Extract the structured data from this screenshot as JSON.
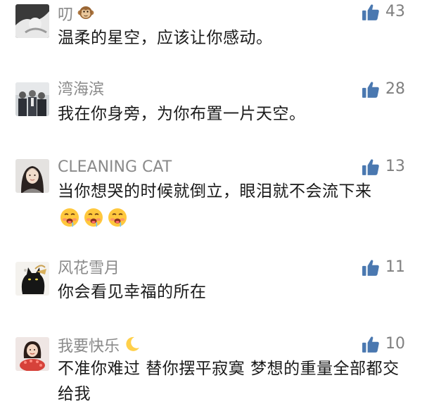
{
  "comments": [
    {
      "name": "叨",
      "text": "温柔的星空，应该让你感动。",
      "likes": "43",
      "name_icon": "monkey-emoji-icon"
    },
    {
      "name": "湾海滨",
      "text": "我在你身旁，为你布置一片天空。",
      "likes": "28"
    },
    {
      "name": "CLEANING CAT",
      "text": "当你想哭的时候就倒立，眼泪就不会流下来",
      "likes": "13",
      "emoji_icon": "drooling-face-emoji-icon",
      "emoji_count": 3
    },
    {
      "name": "风花雪月",
      "text": "你会看见幸福的所在",
      "likes": "11"
    },
    {
      "name": "我要快乐",
      "text": "不准你难过 替你摆平寂寞 梦想的重量全部都交给我",
      "likes": "10",
      "name_icon": "crescent-moon-emoji-icon"
    }
  ],
  "colors": {
    "like_icon": "#4a78b0",
    "name": "#8a8a8a",
    "count": "#7f7f7f",
    "text": "#1a1a1a"
  },
  "icons": {
    "like": "thumbs-up-icon"
  }
}
